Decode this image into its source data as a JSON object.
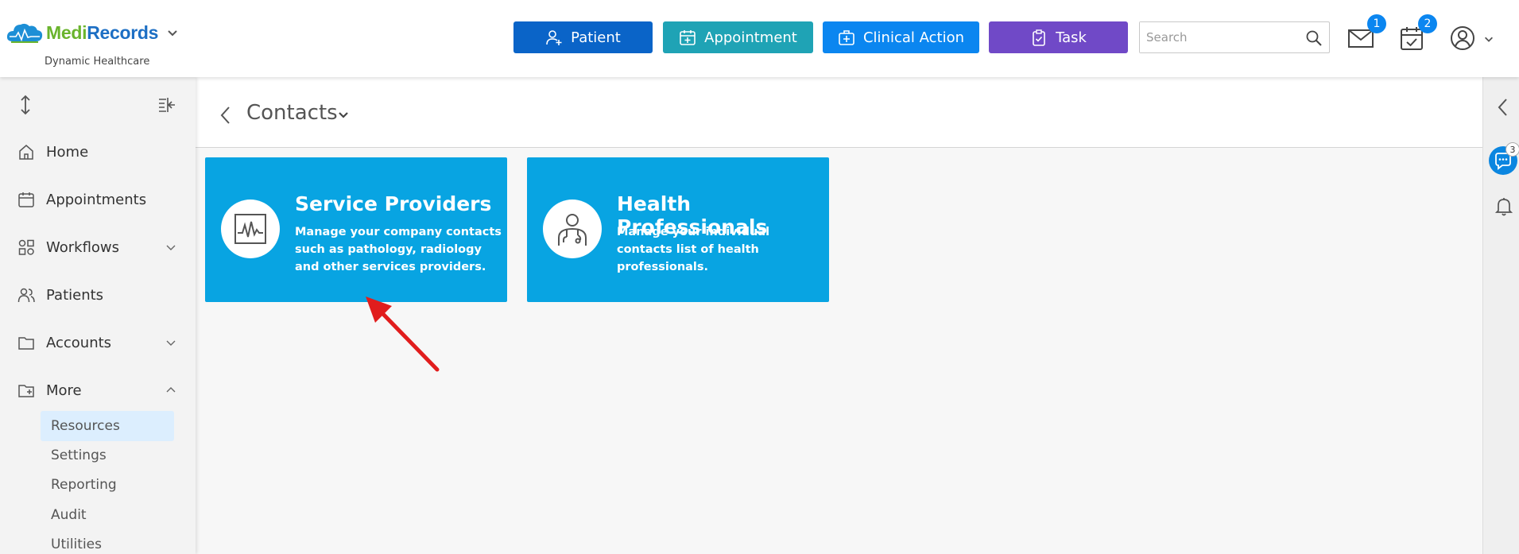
{
  "brand": {
    "name_part1": "Medi",
    "name_part2": "Records",
    "subtitle": "Dynamic Healthcare",
    "color_green": "#6ab42d",
    "color_blue": "#1d6fc4"
  },
  "header": {
    "buttons": [
      {
        "label": "Patient",
        "icon": "user-plus-icon",
        "color": "#0a64c8"
      },
      {
        "label": "Appointment",
        "icon": "calendar-plus-icon",
        "color": "#1fa3b5"
      },
      {
        "label": "Clinical Action",
        "icon": "medical-kit-icon",
        "color": "#0b86f0"
      },
      {
        "label": "Task",
        "icon": "clipboard-check-icon",
        "color": "#7049c7"
      }
    ],
    "search_placeholder": "Search",
    "mail_badge": "1",
    "calendar_badge": "2"
  },
  "sidebar": {
    "items": [
      {
        "label": "Home",
        "icon": "home-icon"
      },
      {
        "label": "Appointments",
        "icon": "calendar-icon"
      },
      {
        "label": "Workflows",
        "icon": "workflow-icon"
      },
      {
        "label": "Patients",
        "icon": "users-icon"
      },
      {
        "label": "Accounts",
        "icon": "folder-icon"
      },
      {
        "label": "More",
        "icon": "folder-plus-icon"
      }
    ],
    "sub_items": [
      "Resources",
      "Settings",
      "Reporting",
      "Audit",
      "Utilities"
    ],
    "active_sub": "Resources"
  },
  "main": {
    "title": "Contacts",
    "cards": [
      {
        "title": "Service Providers",
        "desc": "Manage your company contacts such as pathology, radiology and other services providers.",
        "icon": "pulse-monitor-icon"
      },
      {
        "title": "Health Professionals",
        "desc": "Manage your individual contacts list of health professionals.",
        "icon": "doctor-icon"
      }
    ],
    "card_color": "#08a4e2"
  },
  "rail": {
    "chat_badge": "3"
  }
}
